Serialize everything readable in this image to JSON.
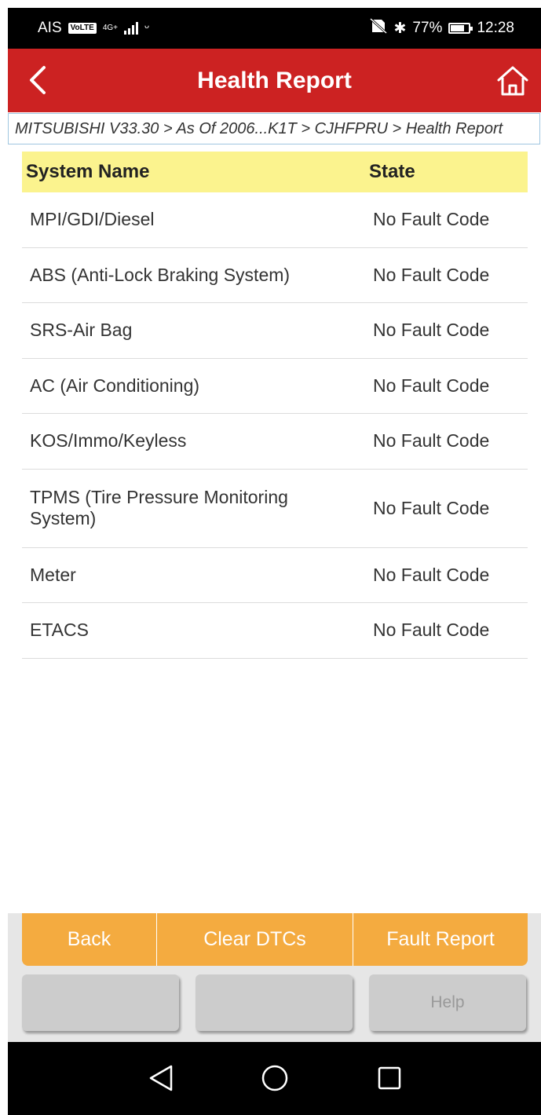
{
  "status_bar": {
    "carrier": "AIS",
    "volte": "VoLTE",
    "network": "4G+",
    "battery_percent": "77%",
    "battery_level": 0.77,
    "time": "12:28"
  },
  "header": {
    "title": "Health Report"
  },
  "breadcrumb": "MITSUBISHI V33.30 > As Of 2006...K1T > CJHFPRU > Health Report",
  "table": {
    "headers": {
      "name": "System Name",
      "state": "State"
    },
    "rows": [
      {
        "name": "MPI/GDI/Diesel",
        "state": "No Fault Code"
      },
      {
        "name": "ABS (Anti-Lock Braking System)",
        "state": "No Fault Code"
      },
      {
        "name": "SRS-Air Bag",
        "state": "No Fault Code"
      },
      {
        "name": "AC (Air Conditioning)",
        "state": "No Fault Code"
      },
      {
        "name": "KOS/Immo/Keyless",
        "state": "No Fault Code"
      },
      {
        "name": "TPMS (Tire Pressure Monitoring System)",
        "state": "No Fault Code"
      },
      {
        "name": "Meter",
        "state": "No Fault Code"
      },
      {
        "name": "ETACS",
        "state": "No Fault Code"
      }
    ]
  },
  "actions": {
    "back": "Back",
    "clear_dtcs": "Clear DTCs",
    "fault_report": "Fault Report"
  },
  "secondary_actions": {
    "btn1": "",
    "btn2": "",
    "help": "Help"
  },
  "colors": {
    "header_red": "#cc2222",
    "table_header_yellow": "#fbf38e",
    "action_orange": "#f4ab40"
  },
  "icons": {
    "back": "chevron-left-icon",
    "home": "home-icon",
    "nav_back": "triangle-back-icon",
    "nav_home": "circle-home-icon",
    "nav_recents": "square-recents-icon"
  }
}
